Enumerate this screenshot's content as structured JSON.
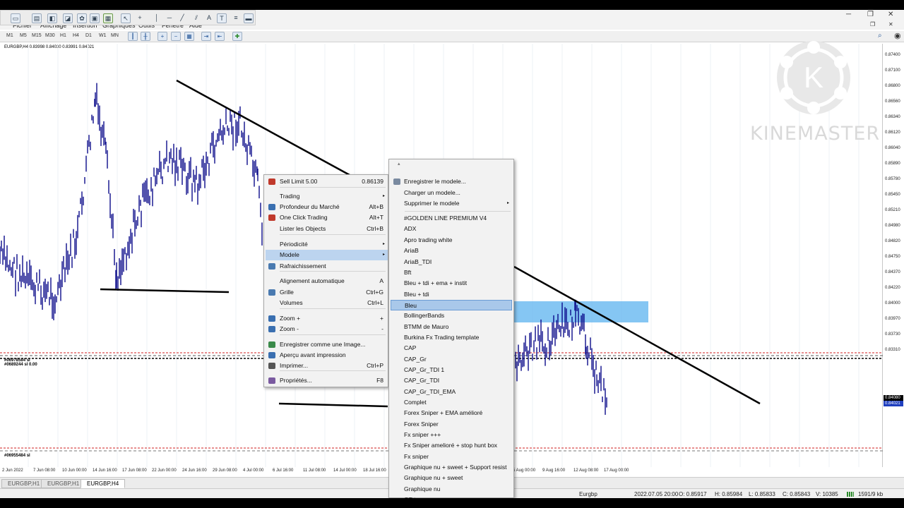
{
  "menubar": {
    "items": [
      "Fichier",
      "Affichage",
      "Insertion",
      "Graphiques",
      "Outils",
      "Fenêtre",
      "Aide"
    ]
  },
  "timeframes": [
    "M1",
    "M5",
    "M15",
    "M30",
    "H1",
    "H4",
    "D1",
    "W1",
    "MN"
  ],
  "chart": {
    "title": "EURGBP,H4  0.83998 0.84030 0.83991 0.84021",
    "price_ticks": [
      "0.87400",
      "0.87100",
      "0.86800",
      "0.86560",
      "0.86340",
      "0.86120",
      "0.86040",
      "0.85890",
      "0.85780",
      "0.85450",
      "0.85210",
      "0.84980",
      "0.84820",
      "0.84750",
      "0.84370",
      "0.84220",
      "0.84000",
      "0.83970",
      "0.83730",
      "0.83310"
    ],
    "current_price_tag": "0.84021",
    "price_tag_2": "0.84080",
    "time_ticks": [
      "2 Jun 2022",
      "7 Jun 08:00",
      "10 Jun 00:00",
      "14 Jun 16:00",
      "17 Jun 08:00",
      "22 Jun 00:00",
      "24 Jun 16:00",
      "29 Jun 08:00",
      "4 Jul 00:00",
      "6 Jul 16:00",
      "11 Jul 08:00",
      "14 Jul 00:00",
      "18 Jul 16:00",
      "5 Aug 00:00",
      "9 Aug 16:00",
      "12 Aug 08:00",
      "17 Aug 00:00"
    ],
    "label_upper": "#06978584 sl",
    "label_upper_2": "#0689244 sl 0.00",
    "label_lower": "#06955484 sl"
  },
  "tabs": [
    "EURGBP,H1",
    "EURGBP,H1",
    "EURGBP,H4"
  ],
  "statusbar": {
    "symbol": "Eurgbp",
    "datetime": "2022.07.05 20:00",
    "open": "O: 0.85917",
    "high": "H: 0.85984",
    "low": "L: 0.85833",
    "close": "C: 0.85843",
    "volume": "V: 10385",
    "traffic": "1591/9 kb"
  },
  "context_menu": {
    "items": [
      {
        "label": "Sell Limit 5.00",
        "shortcut": "0.86139",
        "icon": "sell-limit-icon"
      },
      {
        "label": "Trading",
        "arrow": "▸"
      },
      {
        "label": "Profondeur du Marché",
        "shortcut": "Alt+B",
        "icon": "market-depth-icon"
      },
      {
        "label": "One Click Trading",
        "shortcut": "Alt+T",
        "icon": "one-click-icon"
      },
      {
        "label": "Lister les Objects",
        "shortcut": "Ctrl+B"
      },
      {
        "label": "Périodicité",
        "arrow": "▸"
      },
      {
        "label": "Modele",
        "arrow": "▸"
      },
      {
        "label": "Rafraichissement",
        "icon": "refresh-icon"
      },
      {
        "label": "Alignement automatique",
        "shortcut": "A"
      },
      {
        "label": "Grille",
        "shortcut": "Ctrl+G",
        "icon": "grid-icon"
      },
      {
        "label": "Volumes",
        "shortcut": "Ctrl+L"
      },
      {
        "label": "Zoom +",
        "shortcut": "+",
        "icon": "zoom-in-icon"
      },
      {
        "label": "Zoom -",
        "shortcut": "-",
        "icon": "zoom-out-icon"
      },
      {
        "label": "Enregistrer comme une Image...",
        "icon": "save-image-icon"
      },
      {
        "label": "Aperçu avant impression",
        "icon": "print-preview-icon"
      },
      {
        "label": "Imprimer...",
        "shortcut": "Ctrl+P",
        "icon": "print-icon"
      },
      {
        "label": "Propriétés...",
        "shortcut": "F8",
        "icon": "properties-icon"
      }
    ]
  },
  "template_menu": {
    "items": [
      "Enregistrer le modele...",
      "Charger un modele...",
      "Supprimer le modele",
      "#GOLDEN LINE PREMIUM V4",
      "ADX",
      "Apro trading white",
      "AriaB",
      "AriaB_TDI",
      "Bft",
      "Bleu + tdi + ema + instit",
      "Bleu + tdi",
      "Bleu",
      "BollingerBands",
      "BTMM de Mauro",
      "Burkina Fx Trading template",
      "CAP",
      "CAP_Gr",
      "CAP_Gr_TDI 1",
      "CAP_Gr_TDI",
      "CAP_Gr_TDI_EMA",
      "Complet",
      "Forex Sniper + EMA amélioré",
      "Forex Sniper",
      "Fx sniper +++",
      "Fx Sniper amelioré + stop hunt box",
      "Fx sniper",
      "Graphique nu + sweet + Support resist",
      "Graphique nu + sweet",
      "Graphique nu",
      "GT temp"
    ],
    "submenu_arrow": "▸"
  },
  "watermark": {
    "text": "KINEMASTER",
    "logo_letter": "K"
  },
  "colors": {
    "highlight": "#bcd4ef",
    "selected": "#a9c8ea",
    "candle": "#0a0a8a",
    "price_tag": "#1f3fbf",
    "level_red": "#d02020"
  }
}
